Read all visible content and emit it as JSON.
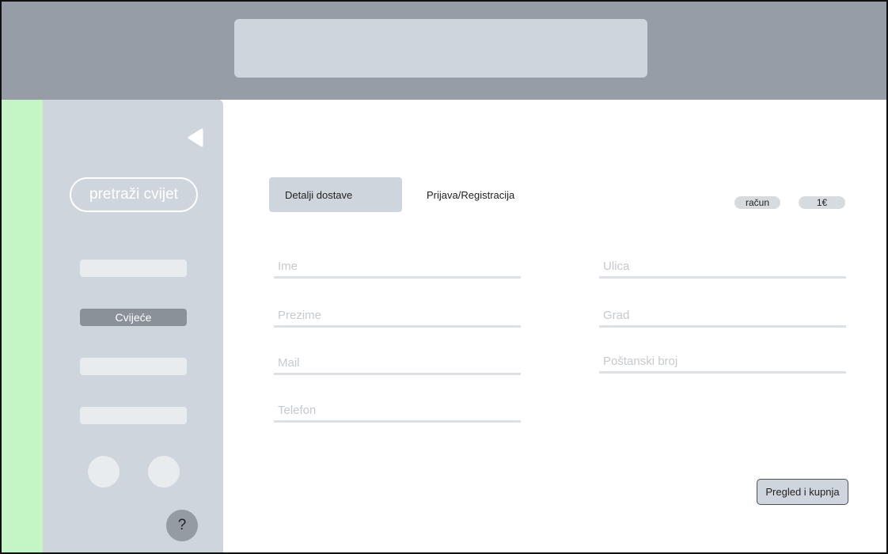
{
  "sidebar": {
    "search_label": "pretraži cvijet",
    "items": [
      {
        "label": ""
      },
      {
        "label": "Cvijeće"
      },
      {
        "label": ""
      },
      {
        "label": ""
      }
    ],
    "help_label": "?"
  },
  "tabs": {
    "details": "Detalji dostave",
    "login": "Prijava/Registracija"
  },
  "chips": {
    "account": "račun",
    "amount": "1€"
  },
  "form": {
    "ime": {
      "placeholder": "Ime",
      "value": ""
    },
    "prezime": {
      "placeholder": "Prezime",
      "value": ""
    },
    "mail": {
      "placeholder": "Mail",
      "value": ""
    },
    "telefon": {
      "placeholder": "Telefon",
      "value": ""
    },
    "ulica": {
      "placeholder": "Ulica",
      "value": ""
    },
    "grad": {
      "placeholder": "Grad",
      "value": ""
    },
    "postanski": {
      "placeholder": "Poštanski broj",
      "value": ""
    }
  },
  "buy_button": "Pregled i kupnja",
  "colors": {
    "header": "#979da6",
    "panel": "#cfd5dc",
    "accent_green": "#c4f5c5"
  }
}
